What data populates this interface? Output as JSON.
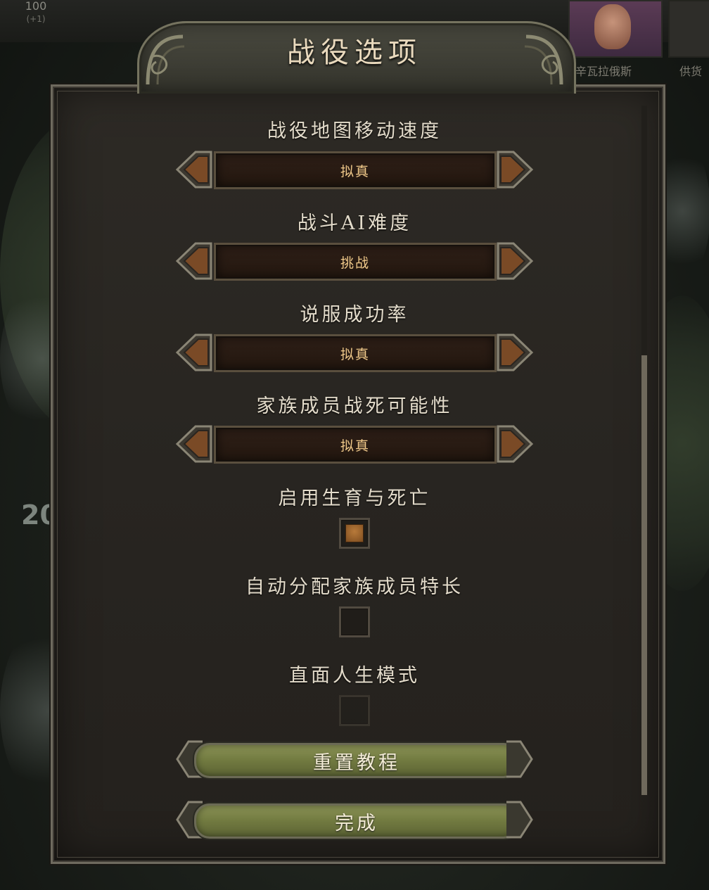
{
  "background": {
    "stat_value": "100",
    "stat_delta": "(+1)",
    "left_number": "20",
    "portrait_name": "辛瓦拉俄斯",
    "right_label": "供货"
  },
  "dialog": {
    "title": "战役选项",
    "options": [
      {
        "label": "战役地图移动速度",
        "type": "selector",
        "value": "拟真"
      },
      {
        "label": "战斗AI难度",
        "type": "selector",
        "value": "挑战"
      },
      {
        "label": "说服成功率",
        "type": "selector",
        "value": "拟真"
      },
      {
        "label": "家族成员战死可能性",
        "type": "selector",
        "value": "拟真"
      },
      {
        "label": "启用生育与死亡",
        "type": "checkbox",
        "checked": true
      },
      {
        "label": "自动分配家族成员特长",
        "type": "checkbox",
        "checked": false
      },
      {
        "label": "直面人生模式",
        "type": "checkbox",
        "checked": false,
        "disabled": true
      }
    ],
    "reset_tutorial_label": "重置教程",
    "done_label": "完成"
  },
  "colors": {
    "accent_text": "#f0c98a",
    "button_green": "#717a40",
    "panel_bg": "#2a2723"
  }
}
